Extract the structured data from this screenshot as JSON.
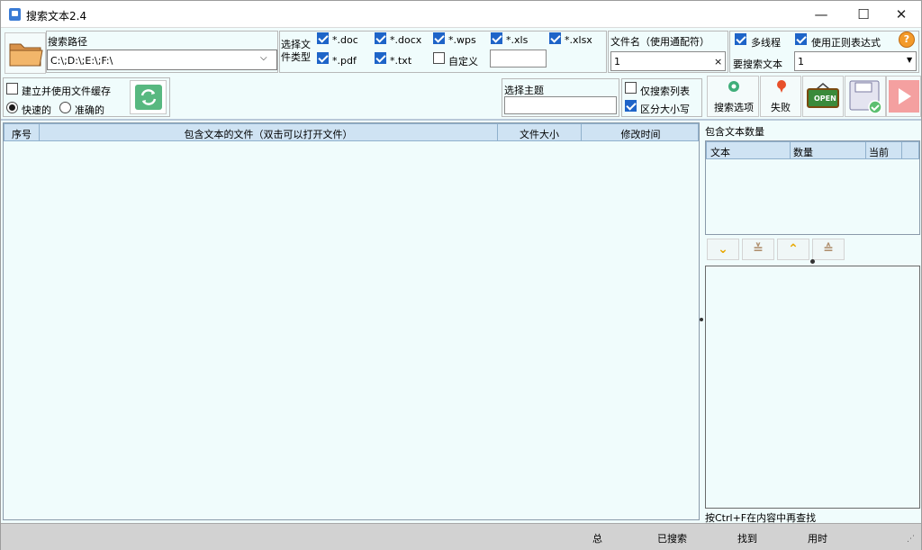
{
  "window": {
    "title": "搜索文本2.4",
    "minimize": "—",
    "maximize": "☐",
    "close": "✕"
  },
  "search_path": {
    "label": "搜索路径",
    "value": "C:\\;D:\\;E:\\;F:\\"
  },
  "file_types": {
    "label": "选择文件类型",
    "items": [
      {
        "label": "*.doc",
        "checked": true
      },
      {
        "label": "*.docx",
        "checked": true
      },
      {
        "label": "*.wps",
        "checked": true
      },
      {
        "label": "*.xls",
        "checked": true
      },
      {
        "label": "*.xlsx",
        "checked": true
      },
      {
        "label": "*.pdf",
        "checked": true
      },
      {
        "label": "*.txt",
        "checked": true
      },
      {
        "label": "自定义",
        "checked": false
      }
    ],
    "custom_value": ""
  },
  "filename": {
    "label": "文件名（使用通配符）",
    "value": "1",
    "clear": "×"
  },
  "options": {
    "multithread": {
      "label": "多线程",
      "checked": true
    },
    "regex": {
      "label": "使用正则表达式",
      "checked": true
    },
    "search_text_label": "要搜索文本",
    "search_text_value": "1",
    "help": "?"
  },
  "cache": {
    "label": "建立并使用文件缓存",
    "checked": false,
    "fast": "快速的",
    "accurate": "准确的"
  },
  "theme": {
    "label": "选择主题",
    "value": ""
  },
  "list_opts": {
    "only_list": {
      "label": "仅搜索列表",
      "checked": false
    },
    "case_sensitive": {
      "label": "区分大小写",
      "checked": true
    }
  },
  "toolbar": {
    "options_label": "搜索选项",
    "fail_label": "失败",
    "open_label": "OPEN"
  },
  "results_table": {
    "columns": [
      "序号",
      "包含文本的文件（双击可以打开文件）",
      "文件大小",
      "修改时间"
    ]
  },
  "count_panel": {
    "title": "包含文本数量",
    "columns": [
      "文本",
      "数量",
      "当前"
    ]
  },
  "hint": "按Ctrl+F在内容中再查找",
  "status": {
    "total": "总",
    "searched": "已搜索",
    "found": "找到",
    "elapsed": "用时"
  },
  "colors": {
    "accent": "#1e64c8",
    "header": "#cfe3f3",
    "background": "#f0fcfc"
  }
}
